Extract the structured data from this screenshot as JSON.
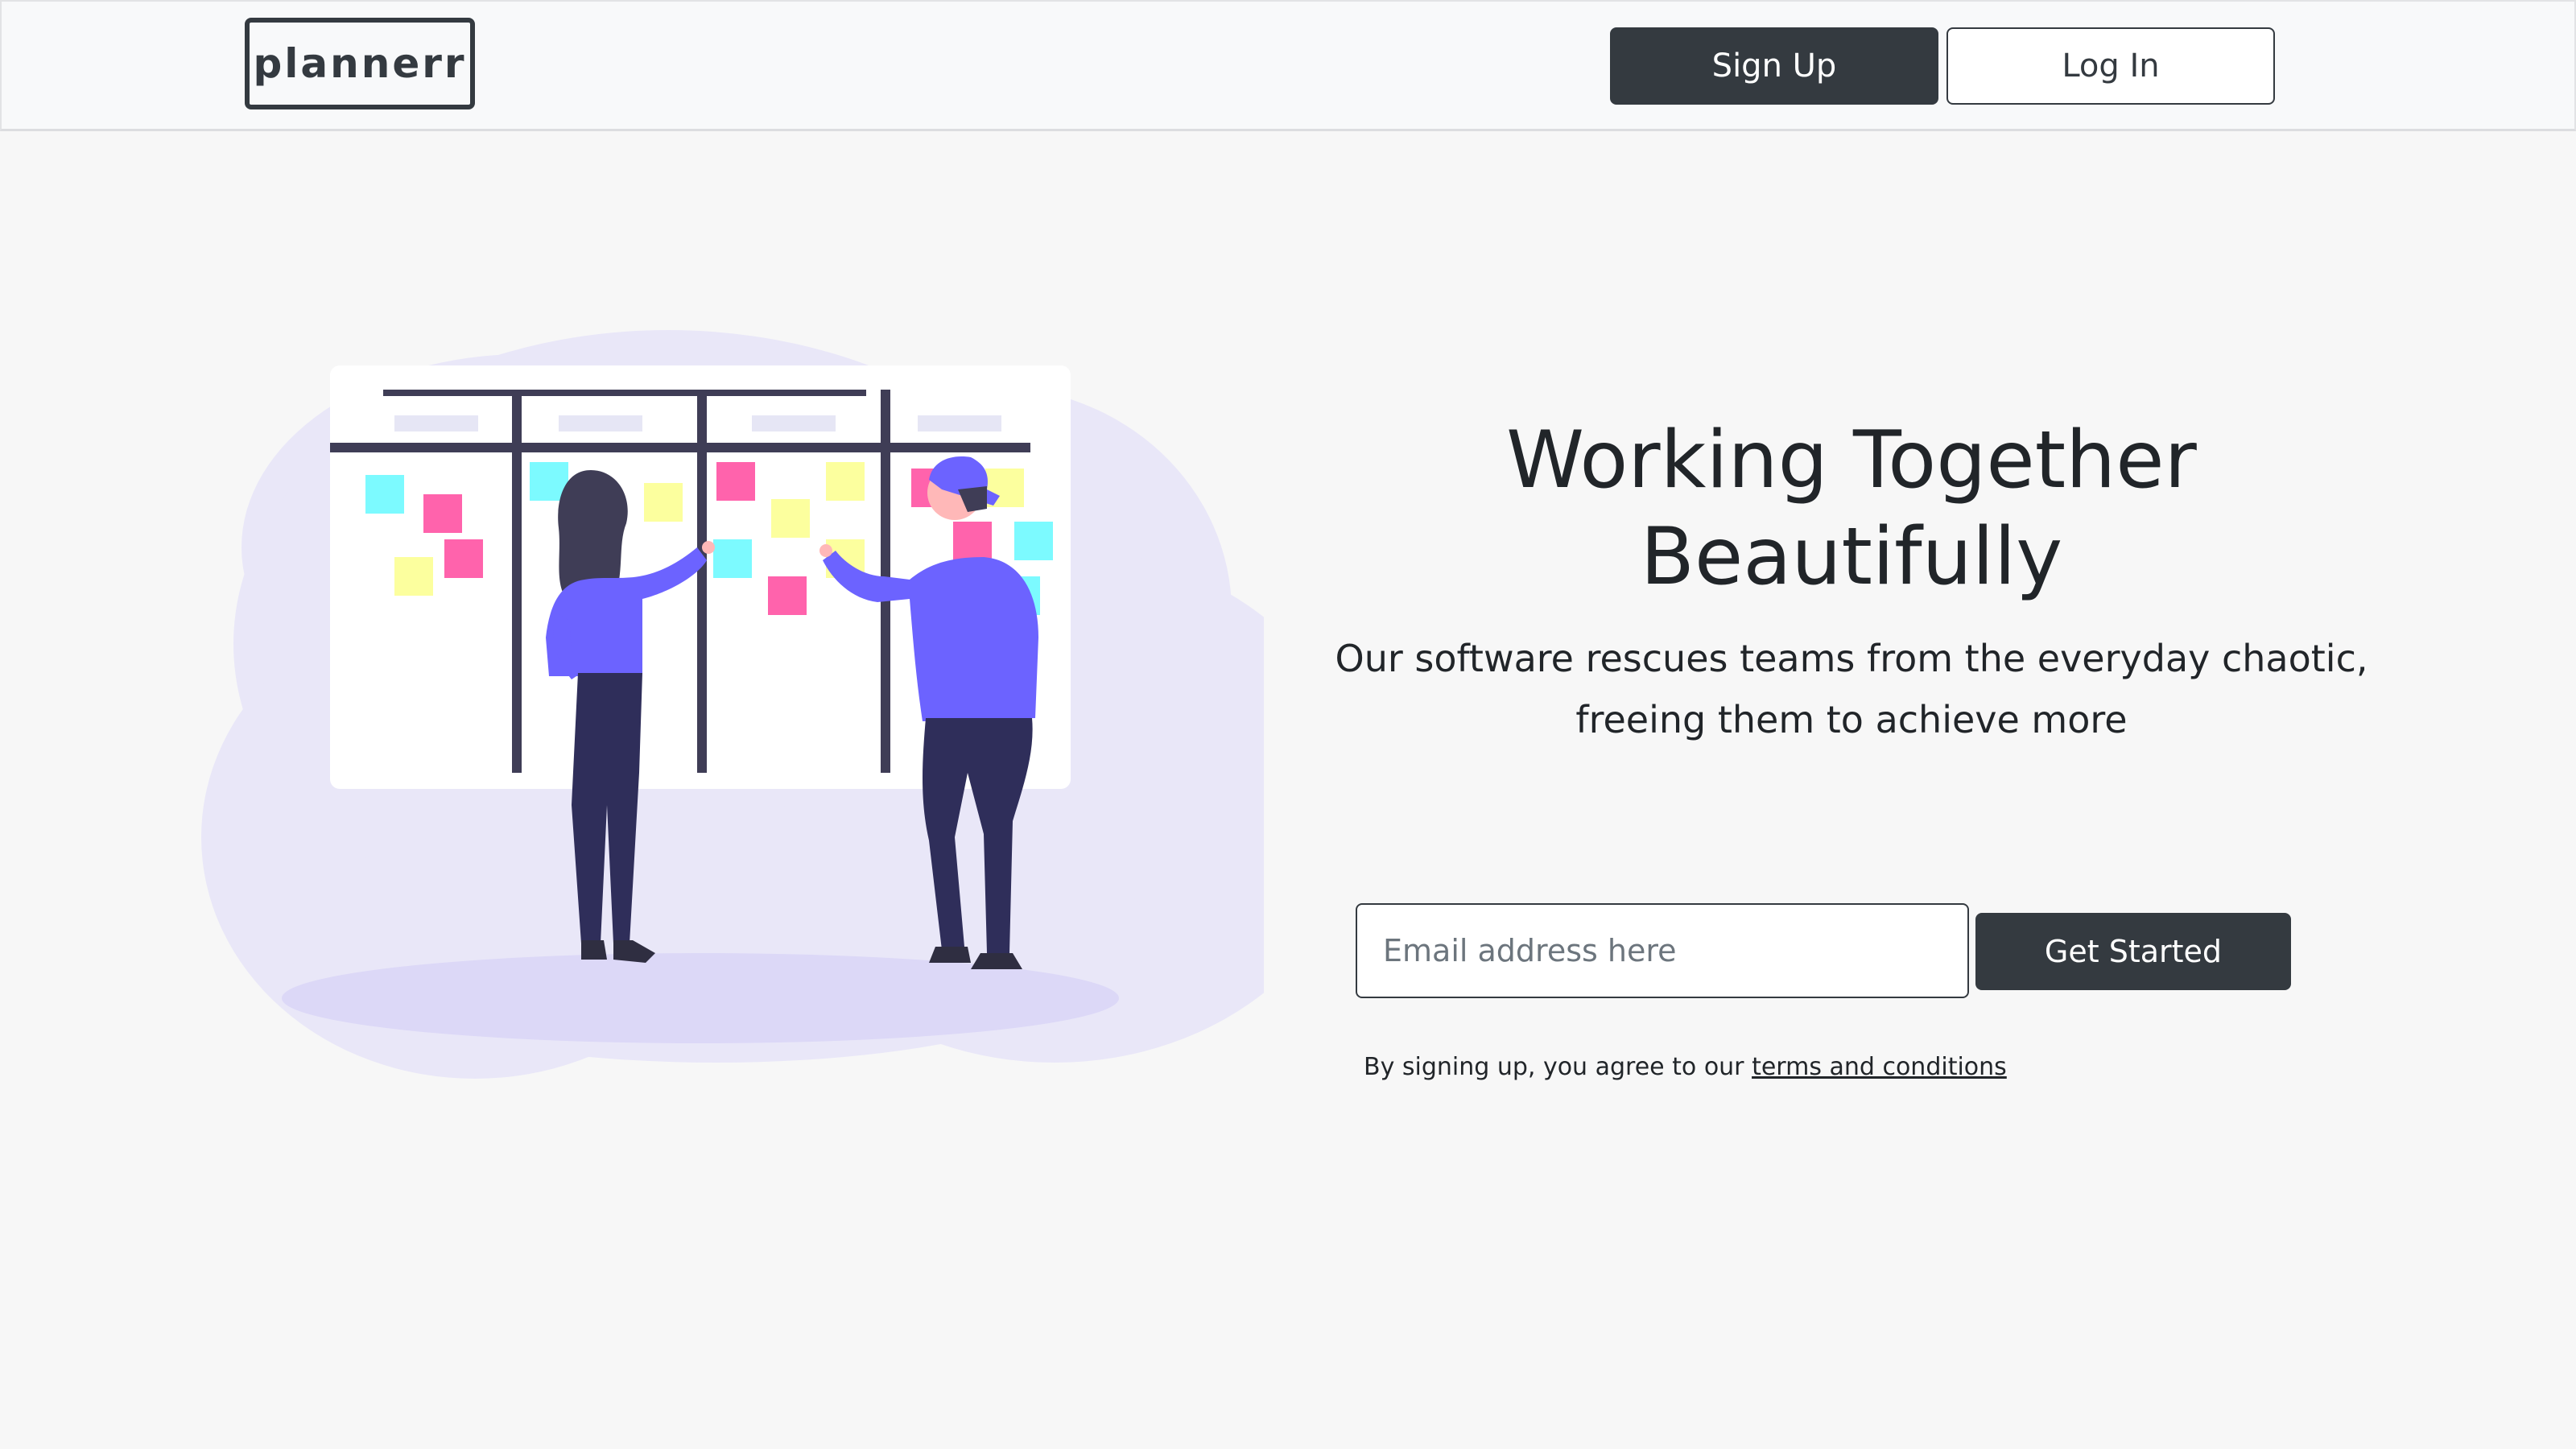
{
  "header": {
    "logo_text": "plannerr",
    "signup_label": "Sign Up",
    "login_label": "Log In"
  },
  "hero": {
    "title_line1": "Working Together",
    "title_line2": "Beautifully",
    "subtitle_line1": "Our software rescues teams from the everyday chaotic,",
    "subtitle_line2": "freeing them to achieve more",
    "illustration": "team-kanban-board-illustration"
  },
  "signup_form": {
    "email_placeholder": "Email address here",
    "email_value": "",
    "cta_label": "Get Started",
    "terms_prefix": "By signing up, you agree to our ",
    "terms_link": "terms and conditions"
  },
  "colors": {
    "dark": "#343a40",
    "accent_purple": "#6c63ff",
    "blob": "#e9e7f8",
    "sticky_pink": "#ff63ac",
    "sticky_cyan": "#7cfaff",
    "sticky_yellow": "#fcff9e"
  }
}
